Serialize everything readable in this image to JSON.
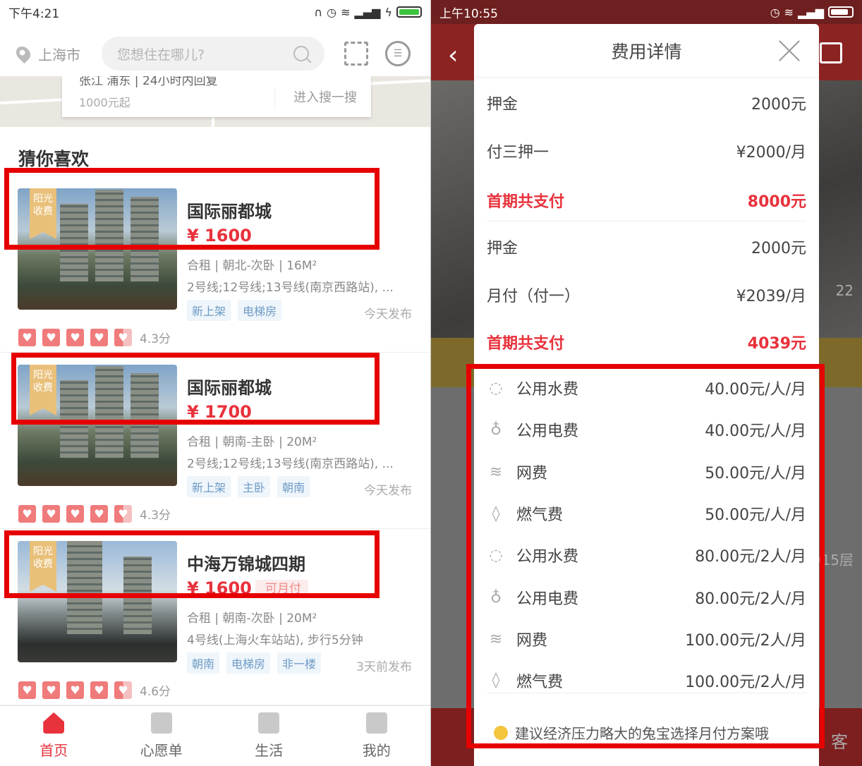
{
  "left": {
    "status": {
      "time": "下午4:21"
    },
    "header": {
      "city": "上海市",
      "search_placeholder": "您想住在哪儿?"
    },
    "map": {
      "card_top": "张江 浦东 | 24小时内回复",
      "card_price": "1000元起",
      "enter": "进入搜一搜"
    },
    "section_title": "猜你喜欢",
    "listings": [
      {
        "ribbon": "阳光收费",
        "title": "国际丽都城",
        "price": "¥ 1600",
        "desc": "合租 | 朝北-次卧 | 16M²",
        "station": "2号线;12号线;13号线(南京西路站), ...",
        "tags": [
          "新上架",
          "电梯房"
        ],
        "published": "今天发布",
        "score": "4.3分"
      },
      {
        "ribbon": "阳光收费",
        "title": "国际丽都城",
        "price": "¥ 1700",
        "desc": "合租 | 朝南-主卧 | 20M²",
        "station": "2号线;12号线;13号线(南京西路站), ...",
        "tags": [
          "新上架",
          "主卧",
          "朝南"
        ],
        "published": "今天发布",
        "score": "4.3分"
      },
      {
        "ribbon": "阳光收费",
        "title": "中海万锦城四期",
        "price": "¥ 1600",
        "badge": "可月付",
        "desc": "合租 | 朝南-次卧 | 20M²",
        "station": "4号线(上海火车站站), 步行5分钟",
        "tags": [
          "朝南",
          "电梯房",
          "非一楼"
        ],
        "published": "3天前发布",
        "score": "4.6分"
      }
    ],
    "tabs": [
      {
        "label": "首页"
      },
      {
        "label": "心愿单"
      },
      {
        "label": "生活"
      },
      {
        "label": "我的"
      }
    ]
  },
  "right": {
    "status": {
      "time": "上午10:55"
    },
    "modal": {
      "title": "费用详情",
      "plan1": [
        {
          "label": "押金",
          "value": "2000元"
        },
        {
          "label": "付三押一",
          "value": "¥2000/月"
        },
        {
          "label": "首期共支付",
          "value": "8000元"
        }
      ],
      "plan2": [
        {
          "label": "押金",
          "value": "2000元"
        },
        {
          "label": "月付（付一）",
          "value": "¥2039/月"
        },
        {
          "label": "首期共支付",
          "value": "4039元"
        }
      ],
      "fees": [
        {
          "icon": "water-drop-icon",
          "label": "公用水费",
          "value": "40.00元/人/月"
        },
        {
          "icon": "lightbulb-icon",
          "label": "公用电费",
          "value": "40.00元/人/月"
        },
        {
          "icon": "wifi-icon",
          "label": "网费",
          "value": "50.00元/人/月"
        },
        {
          "icon": "flame-icon",
          "label": "燃气费",
          "value": "50.00元/人/月"
        },
        {
          "icon": "water-drop-icon",
          "label": "公用水费",
          "value": "80.00元/2人/月"
        },
        {
          "icon": "lightbulb-icon",
          "label": "公用电费",
          "value": "80.00元/2人/月"
        },
        {
          "icon": "wifi-icon",
          "label": "网费",
          "value": "100.00元/2人/月"
        },
        {
          "icon": "flame-icon",
          "label": "燃气费",
          "value": "100.00元/2人/月"
        }
      ],
      "tip": "建议经济压力略大的兔宝选择月付方案哦"
    },
    "background": {
      "page_counter": "22",
      "floor": "/15层",
      "bottom_text": "客"
    }
  },
  "colors": {
    "accent": "#e8323c",
    "highlight_box": "#e60000",
    "ribbon": "#e9c07a"
  }
}
